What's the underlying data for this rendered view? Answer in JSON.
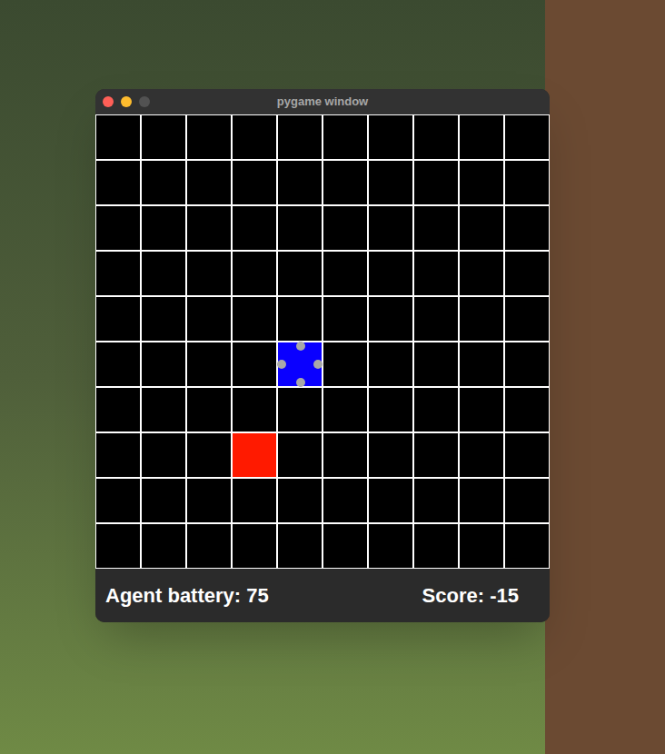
{
  "window": {
    "title": "pygame window",
    "controls": [
      {
        "kind": "close",
        "disabled": false,
        "color": "#ff5f57"
      },
      {
        "kind": "minimize",
        "disabled": false,
        "color": "#febc2e"
      },
      {
        "kind": "zoom",
        "disabled": true,
        "color": "#5a5a5a"
      }
    ]
  },
  "grid": {
    "rows": 10,
    "cols": 10
  },
  "entities": [
    {
      "kind": "agent",
      "row": 5,
      "col": 4,
      "color": "#0a00ff"
    },
    {
      "kind": "target",
      "row": 7,
      "col": 3,
      "color": "#ff1a00"
    }
  ],
  "status_bar": {
    "battery": "Agent battery: 75",
    "score": "Score: -15"
  }
}
